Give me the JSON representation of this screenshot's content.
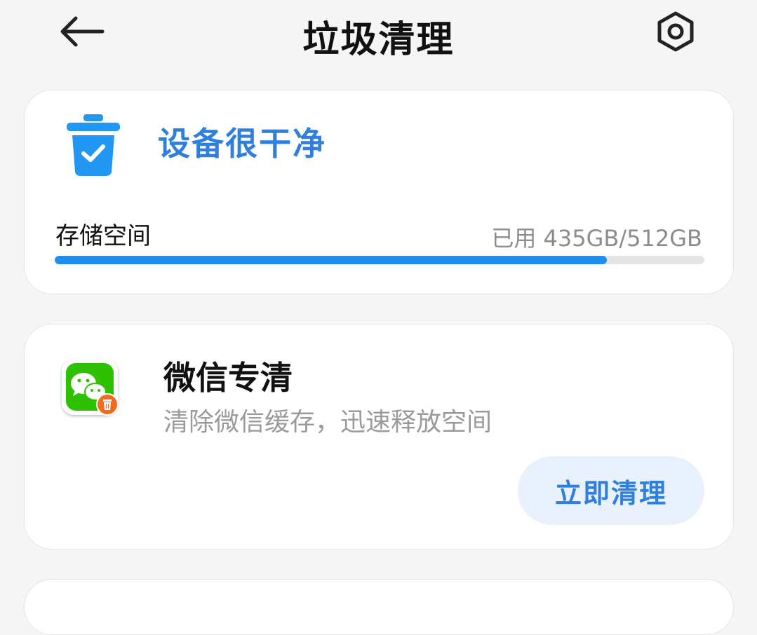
{
  "header": {
    "title": "垃圾清理",
    "back_icon": "arrow-left-icon",
    "settings_icon": "gear-icon"
  },
  "status_card": {
    "icon": "trash-check-icon",
    "status": "设备很干净",
    "storage_label": "存储空间",
    "storage_used": "已用 435GB/512GB",
    "storage_used_fraction": 0.85,
    "accent_color": "#2f7fde",
    "bar_color": "#1e8ff0"
  },
  "wechat_card": {
    "icon": "wechat-clean-icon",
    "title": "微信专清",
    "description": "清除微信缓存，迅速释放空间",
    "button_label": "立即清理"
  }
}
